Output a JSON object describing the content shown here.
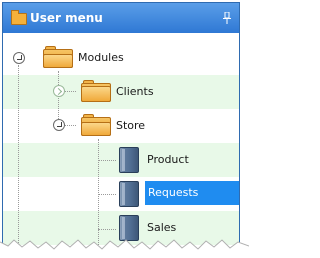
{
  "panel": {
    "title": "User menu",
    "title_icon": "folder-icon",
    "pin_icon": "pin-icon"
  },
  "tree": {
    "items": [
      {
        "label": "Modules",
        "icon": "folder-open-icon",
        "expanded": true
      },
      {
        "label": "Clients",
        "icon": "folder-icon",
        "expanded": false
      },
      {
        "label": "Store",
        "icon": "folder-open-icon",
        "expanded": true
      },
      {
        "label": "Product",
        "icon": "book-icon"
      },
      {
        "label": "Requests",
        "icon": "book-icon",
        "selected": true
      },
      {
        "label": "Sales",
        "icon": "book-icon"
      }
    ]
  },
  "colors": {
    "header": "#2f78d4",
    "row_alt": "#e8f9e8",
    "selection": "#1f8cf0"
  }
}
